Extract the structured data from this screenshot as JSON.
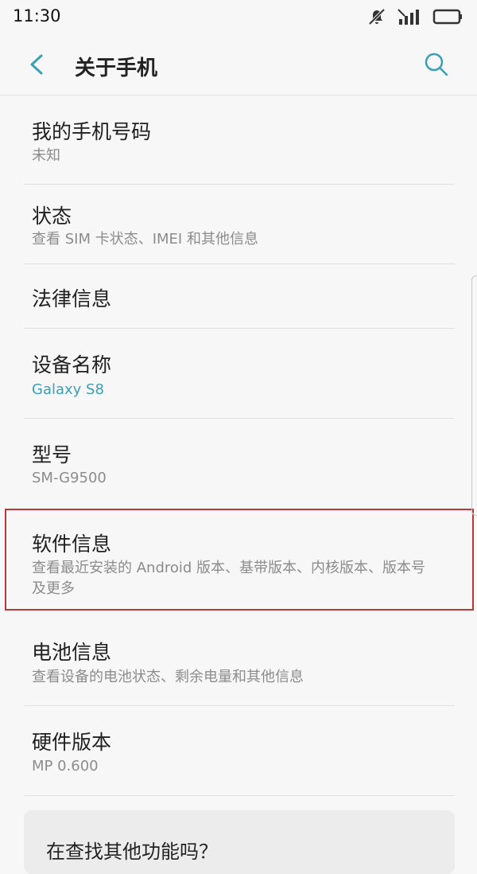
{
  "status_bar": {
    "time": "11:30",
    "icons": [
      "mute-icon",
      "signal-icon",
      "battery-icon"
    ]
  },
  "app_bar": {
    "title": "关于手机",
    "back_icon": "chevron-left-icon",
    "search_icon": "search-icon",
    "accent_color": "#3aa0b3"
  },
  "items": [
    {
      "title": "我的手机号码",
      "subtitle": "未知"
    },
    {
      "title": "状态",
      "subtitle": "查看 SIM 卡状态、IMEI 和其他信息"
    },
    {
      "title": "法律信息",
      "subtitle": ""
    },
    {
      "title": "设备名称",
      "subtitle": "Galaxy S8"
    },
    {
      "title": "型号",
      "subtitle": "SM-G9500"
    },
    {
      "title": "软件信息",
      "subtitle": "查看最近安装的 Android 版本、基带版本、内核版本、版本号及更多"
    },
    {
      "title": "电池信息",
      "subtitle": "查看设备的电池状态、剩余电量和其他信息"
    },
    {
      "title": "硬件版本",
      "subtitle": "MP 0.600"
    }
  ],
  "suggest": {
    "title": "在查找其他功能吗？"
  },
  "highlight_color": "#b73a3a"
}
